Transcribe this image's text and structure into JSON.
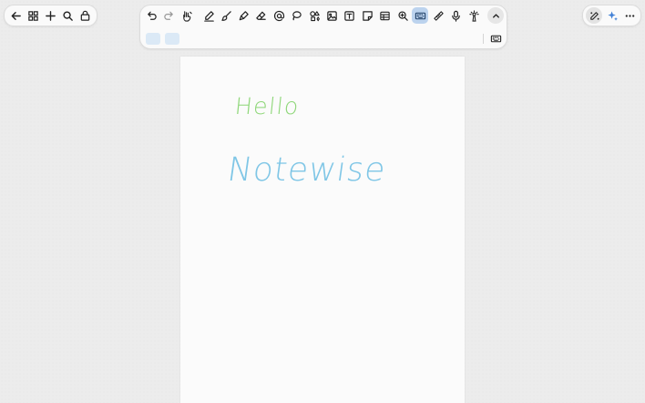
{
  "canvas": {
    "handwriting": [
      {
        "text": "Hello",
        "color": "#8fd77a"
      },
      {
        "text": "Notewise",
        "color": "#7fc6e6"
      }
    ]
  },
  "icons": {
    "left_toolbar": [
      "back-arrow-icon",
      "grid-icon",
      "plus-icon",
      "search-icon",
      "lock-icon"
    ],
    "main_toolbar": [
      "undo-icon",
      "redo-icon",
      "hand-pen-icon",
      "pen-icon",
      "brush-icon",
      "highlighter-icon",
      "eraser-icon",
      "at-sign-icon",
      "lasso-icon",
      "shapes-icon",
      "image-icon",
      "text-box-icon",
      "sticky-note-icon",
      "table-icon",
      "zoom-in-icon",
      "keyboard-icon",
      "ruler-icon",
      "microphone-icon",
      "laser-pointer-icon",
      "chevron-up-icon"
    ],
    "right_toolbar": [
      "magic-pen-icon",
      "sparkle-icon",
      "more-icon"
    ]
  },
  "colors": {
    "accent": "#bcd3ee",
    "icon": "#222222"
  }
}
